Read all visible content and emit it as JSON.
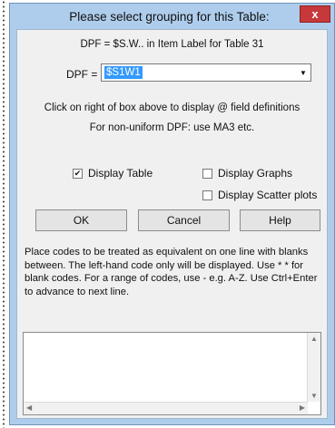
{
  "dialog": {
    "title": "Please select grouping for this Table:",
    "close_label": "x"
  },
  "header_line": "DPF = $S.W.. in Item Label for Table 31",
  "dpf": {
    "label": "DPF =",
    "value": "$S1W1",
    "dropdown_icon": "chevron-down-icon"
  },
  "hints": {
    "line1": "Click on right of box above to display @ field definitions",
    "line2": "For non-uniform DPF: use MA3 etc."
  },
  "checkboxes": {
    "display_table": {
      "label": "Display Table",
      "checked": true
    },
    "display_graphs": {
      "label": "Display Graphs",
      "checked": false
    },
    "display_scatter": {
      "label": "Display Scatter plots",
      "checked": false
    }
  },
  "buttons": {
    "ok": "OK",
    "cancel": "Cancel",
    "help": "Help"
  },
  "instructions": "Place codes to be treated as equivalent on one line with blanks between. The left-hand code only will be displayed. Use * * for blank codes. For a range of codes, use - e.g. A-Z. Use Ctrl+Enter to advance to next line.",
  "codes_text": "",
  "colors": {
    "title_bar": "#aecdec",
    "close_button": "#c7383a",
    "selection": "#3399ff"
  }
}
